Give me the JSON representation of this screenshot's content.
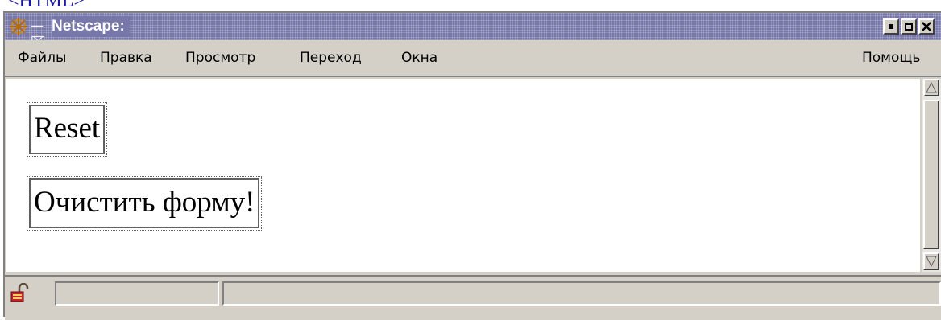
{
  "page_top_fragment": "<HTML>",
  "window": {
    "title": "Netscape:",
    "icons": {
      "app": "netscape-wheel-icon",
      "pin": "pin-icon"
    },
    "controls": [
      "minimize-icon",
      "maximize-icon",
      "close-icon"
    ],
    "colors": {
      "titlebar": "#7777aa",
      "chrome": "#d4d0c8",
      "top_text": "#1a1aa0"
    }
  },
  "menu": {
    "items": [
      "Файлы",
      "Правка",
      "Просмотр",
      "Переход",
      "Окна"
    ],
    "help": "Помощь"
  },
  "content": {
    "reset_button": "Reset",
    "clear_button": "Очистить форму!"
  },
  "status": {
    "security_icon": "unlocked-padlock-icon",
    "fields": [
      "",
      ""
    ]
  }
}
